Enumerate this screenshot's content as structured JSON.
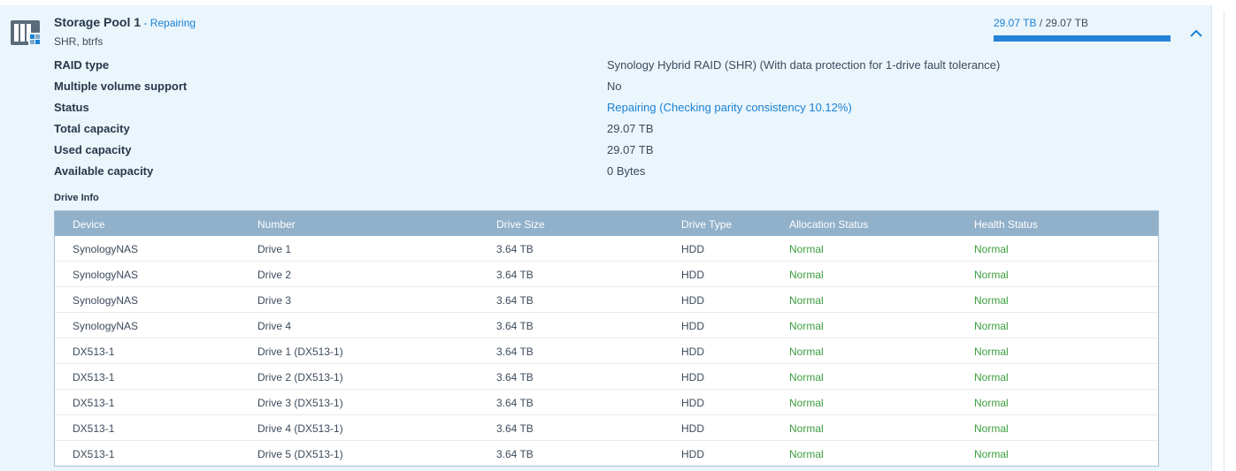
{
  "pool": {
    "title": "Storage Pool 1",
    "separator": " - ",
    "status": "Repairing",
    "subtitle": "SHR, btrfs",
    "icon": "storage-pool-icon",
    "usage": {
      "used": "29.07 TB",
      "sep": " / ",
      "total": "29.07 TB",
      "fraction": 1.0
    }
  },
  "properties": [
    {
      "label": "RAID type",
      "value": "Synology Hybrid RAID (SHR) (With data protection for 1-drive fault tolerance)"
    },
    {
      "label": "Multiple volume support",
      "value": "No"
    },
    {
      "label": "Status",
      "value_link": "Repairing",
      "value_mid_open": " (",
      "value_link2": "Checking parity consistency 10.12%",
      "value_mid_close": ")"
    },
    {
      "label": "Total capacity",
      "value": "29.07 TB"
    },
    {
      "label": "Used capacity",
      "value": "29.07 TB"
    },
    {
      "label": "Available capacity",
      "value": "0 Bytes"
    }
  ],
  "drive_info": {
    "title": "Drive Info",
    "columns": [
      "Device",
      "Number",
      "Drive Size",
      "Drive Type",
      "Allocation Status",
      "Health Status"
    ],
    "rows": [
      [
        "SynologyNAS",
        "Drive 1",
        "3.64 TB",
        "HDD",
        "Normal",
        "Normal"
      ],
      [
        "SynologyNAS",
        "Drive 2",
        "3.64 TB",
        "HDD",
        "Normal",
        "Normal"
      ],
      [
        "SynologyNAS",
        "Drive 3",
        "3.64 TB",
        "HDD",
        "Normal",
        "Normal"
      ],
      [
        "SynologyNAS",
        "Drive 4",
        "3.64 TB",
        "HDD",
        "Normal",
        "Normal"
      ],
      [
        "DX513-1",
        "Drive 1 (DX513-1)",
        "3.64 TB",
        "HDD",
        "Normal",
        "Normal"
      ],
      [
        "DX513-1",
        "Drive 2 (DX513-1)",
        "3.64 TB",
        "HDD",
        "Normal",
        "Normal"
      ],
      [
        "DX513-1",
        "Drive 3 (DX513-1)",
        "3.64 TB",
        "HDD",
        "Normal",
        "Normal"
      ],
      [
        "DX513-1",
        "Drive 4 (DX513-1)",
        "3.64 TB",
        "HDD",
        "Normal",
        "Normal"
      ],
      [
        "DX513-1",
        "Drive 5 (DX513-1)",
        "3.64 TB",
        "HDD",
        "Normal",
        "Normal"
      ]
    ]
  },
  "colors": {
    "accent": "#1a82d4",
    "normal": "#3a9e3e",
    "header": "#91b0c9",
    "panel": "#ebf5fc"
  },
  "icons": {
    "collapse": "chevron-up-icon"
  }
}
